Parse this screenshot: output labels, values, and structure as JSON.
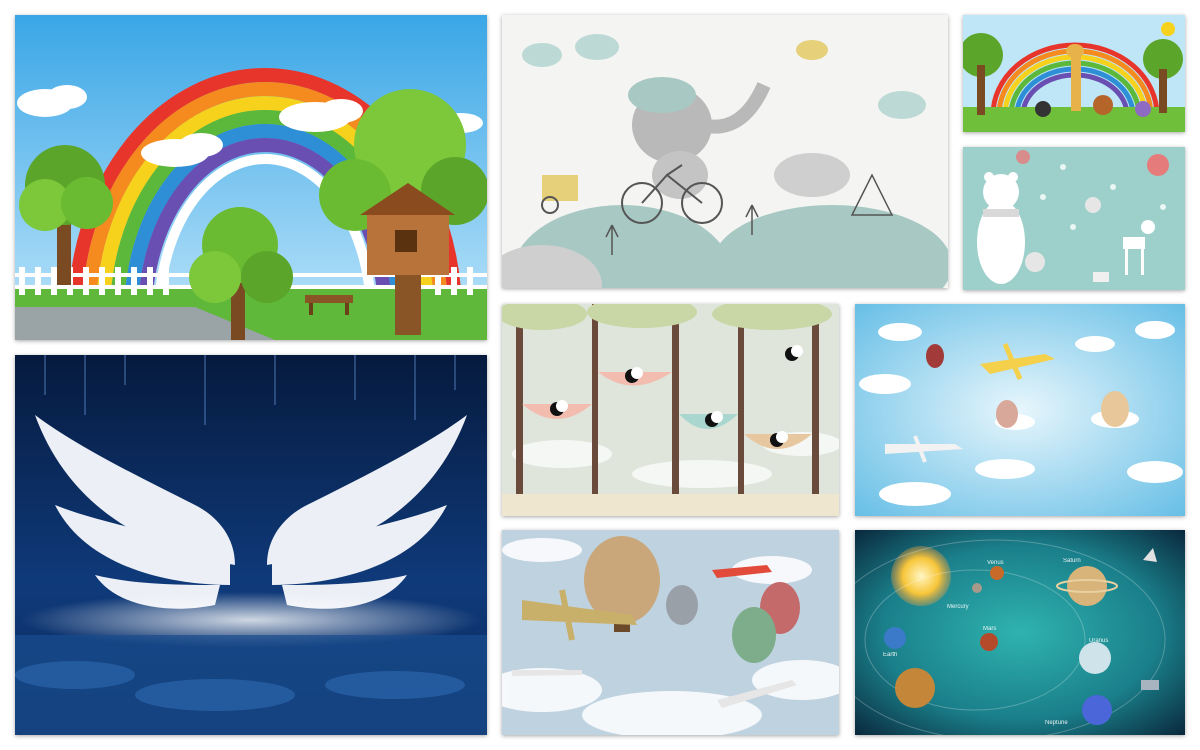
{
  "gallery": {
    "tiles": [
      {
        "name": "rainbow-treehouse-mural",
        "theme": "rainbow, trees, treehouse, fence"
      },
      {
        "name": "elephant-bicycle-mural",
        "theme": "elephant riding bicycle, mice, hills"
      },
      {
        "name": "rainbow-animals-mural",
        "theme": "giraffe, animals under a rainbow"
      },
      {
        "name": "winter-bear-deer-mural",
        "theme": "polar bear, deer, balloons, snowflakes"
      },
      {
        "name": "angel-wings-mural",
        "theme": "white wings, night sky, moon"
      },
      {
        "name": "pandas-hammocks-mural",
        "theme": "pandas in hammocks between trees"
      },
      {
        "name": "planes-balloons-blue-mural",
        "theme": "planes, hot-air balloons, clouds"
      },
      {
        "name": "vintage-balloons-planes-mural",
        "theme": "biplanes, hot-air balloons, clouds"
      },
      {
        "name": "solar-system-mural",
        "theme": "sun and planets in space"
      }
    ],
    "solar_system_labels": {
      "saturn": "Saturn",
      "venus": "Venus",
      "mercury": "Mercury",
      "earth": "Earth",
      "mars": "Mars",
      "uranus": "Uranus",
      "neptune": "Neptune"
    },
    "colors": {
      "rainbow": [
        "#e8352b",
        "#f58a1f",
        "#f7d21c",
        "#5cb83a",
        "#2f8fd6",
        "#6a4fb3"
      ],
      "sky_blue": "#4bb4ea",
      "night_blue": "#0b2a5c",
      "mint": "#a8c9c3",
      "space_teal": "#1a7f8a"
    }
  }
}
